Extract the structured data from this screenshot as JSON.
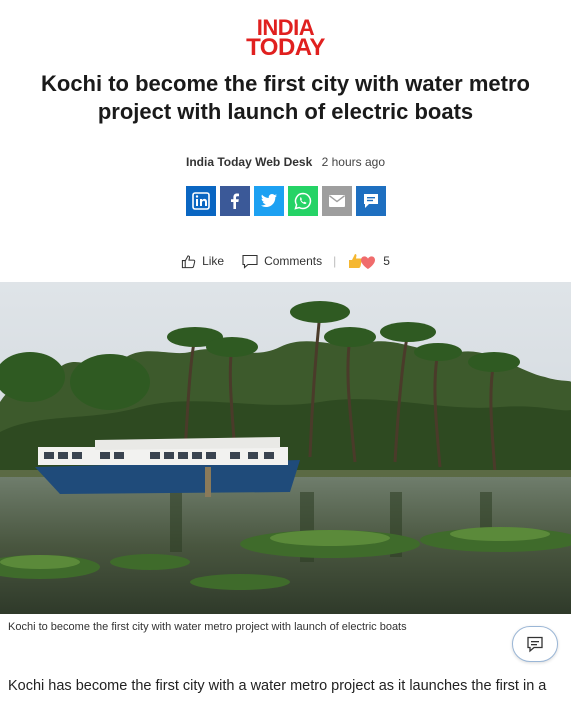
{
  "brand": {
    "line1": "INDIA",
    "line2": "TODAY",
    "color": "#e0201f"
  },
  "article": {
    "headline": "Kochi to become the first city with water metro project with launch of electric boats",
    "author": "India Today Web Desk",
    "time": "2 hours ago",
    "caption": "Kochi to become the first city with water metro project with launch of electric boats",
    "body_first_line": "Kochi has become the first city with a water metro project as it launches the first in a"
  },
  "share": [
    {
      "name": "linkedin",
      "label": "in",
      "color": "#0a66c2"
    },
    {
      "name": "facebook",
      "label": "f",
      "color": "#3b5998"
    },
    {
      "name": "twitter",
      "label": "t",
      "color": "#1da1f2"
    },
    {
      "name": "whatsapp",
      "label": "w",
      "color": "#25d366"
    },
    {
      "name": "email",
      "label": "e",
      "color": "#9e9e9e"
    },
    {
      "name": "teams",
      "label": "m",
      "color": "#1e6fc0"
    }
  ],
  "reactions": {
    "like_label": "Like",
    "comments_label": "Comments",
    "count": "5"
  }
}
